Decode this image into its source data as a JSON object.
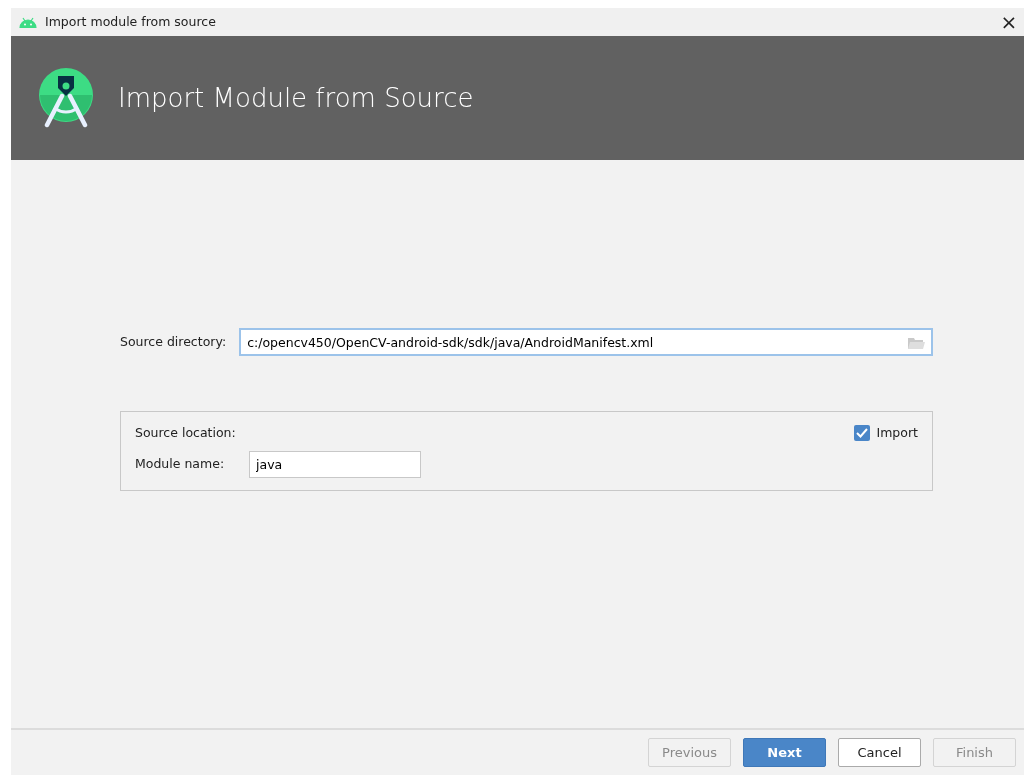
{
  "window": {
    "title": "Import module from source",
    "close": "×"
  },
  "header": {
    "title": "Import Module from Source"
  },
  "source_directory": {
    "label": "Source directory:",
    "value": "c:/opencv450/OpenCV-android-sdk/sdk/java/AndroidManifest.xml",
    "focused": true
  },
  "source_location": {
    "label": "Source location:",
    "import_checkbox": {
      "label": "Import",
      "checked": true
    },
    "module_name": {
      "label": "Module name:",
      "value": "java"
    }
  },
  "buttons": [
    {
      "label": "Previous",
      "kind": "default",
      "disabled": true
    },
    {
      "label": "Next",
      "kind": "primary",
      "disabled": false
    },
    {
      "label": "Cancel",
      "kind": "default",
      "disabled": false
    },
    {
      "label": "Finish",
      "kind": "default",
      "disabled": true
    }
  ]
}
